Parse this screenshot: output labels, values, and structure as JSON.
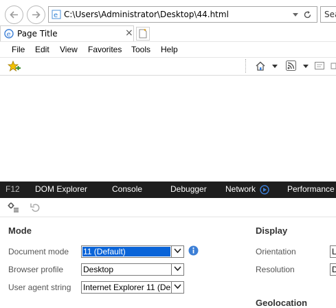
{
  "browser": {
    "url": "C:\\Users\\Administrator\\Desktop\\44.html",
    "search_placeholder": "Sea",
    "tab_title": "Page Title",
    "menu": [
      "File",
      "Edit",
      "View",
      "Favorites",
      "Tools",
      "Help"
    ]
  },
  "devtools": {
    "f12_label": "F12",
    "tabs": [
      "DOM Explorer",
      "Console",
      "Debugger",
      "Network",
      "Performance"
    ],
    "mode": {
      "heading": "Mode",
      "document_mode_label": "Document mode",
      "document_mode_value": "11 (Default)",
      "browser_profile_label": "Browser profile",
      "browser_profile_value": "Desktop",
      "user_agent_label": "User agent string",
      "user_agent_value": "Internet Explorer 11 (De"
    },
    "display": {
      "heading": "Display",
      "orientation_label": "Orientation",
      "orientation_value": "La",
      "resolution_label": "Resolution",
      "resolution_value": "D"
    },
    "geolocation_heading": "Geolocation"
  },
  "colors": {
    "accent_blue": "#3c7fd6",
    "selection_blue": "#0a64d8",
    "devtools_bar": "#1e1e1e"
  }
}
